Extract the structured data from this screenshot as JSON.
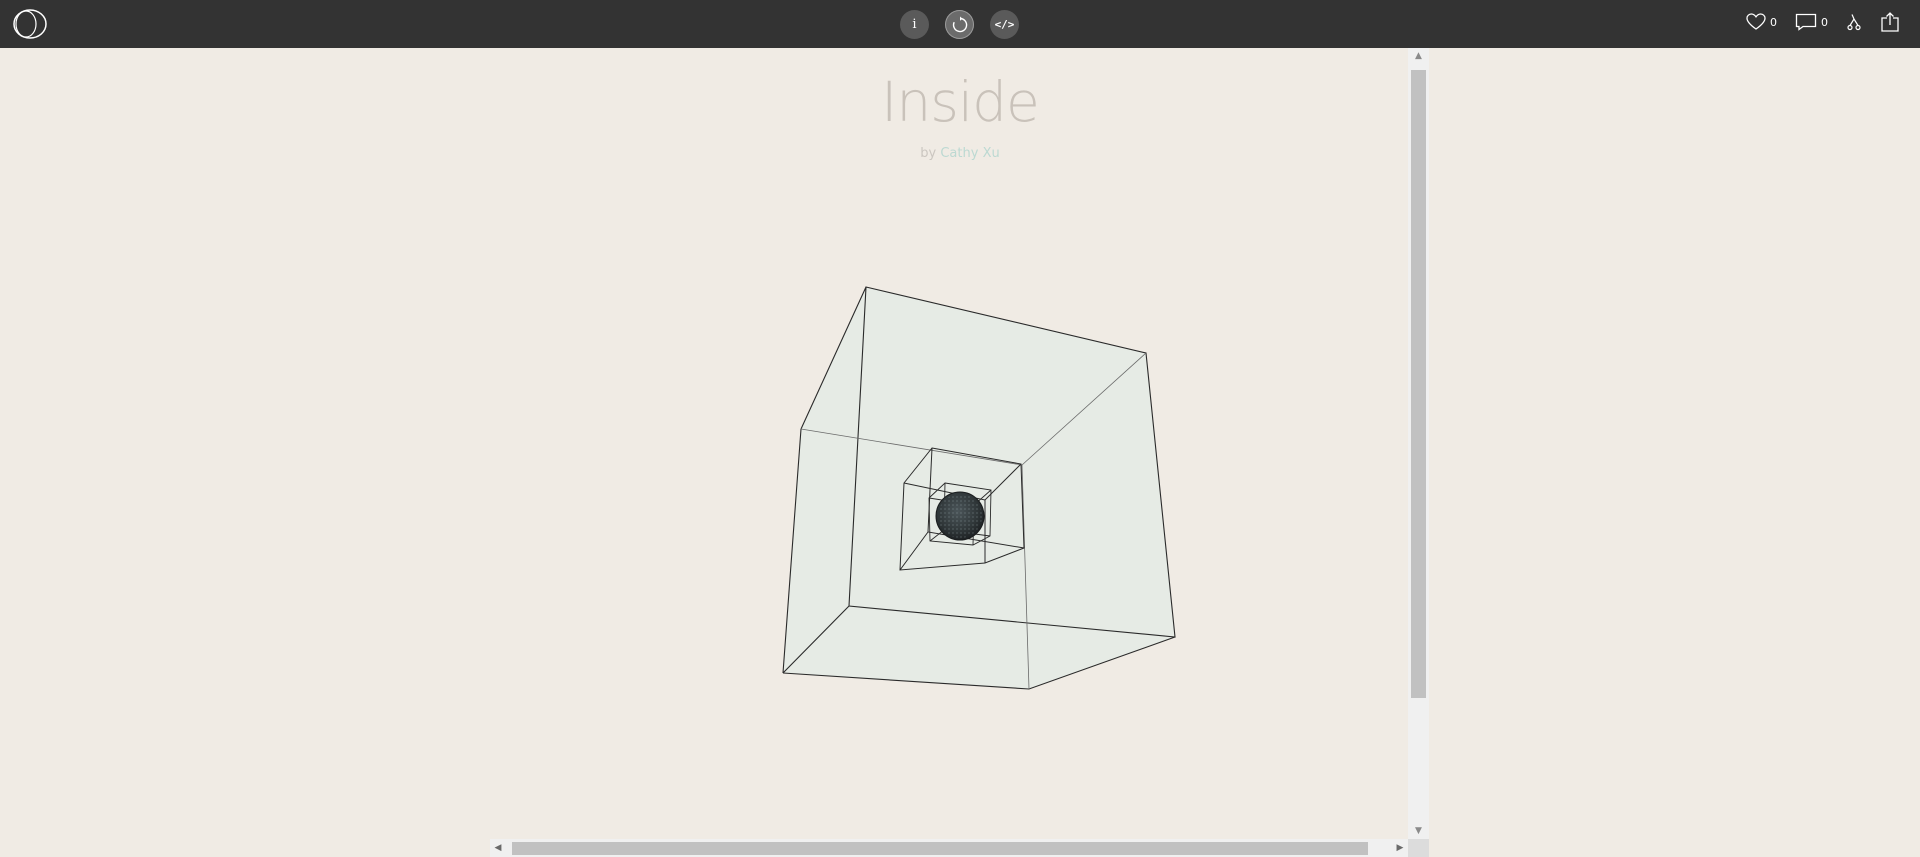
{
  "topbar": {
    "logo_icon": "openprocessing-logo-icon",
    "controls": [
      {
        "name": "info",
        "label": "i",
        "icon": "info-icon"
      },
      {
        "name": "restart",
        "label": "",
        "icon": "restart-icon"
      },
      {
        "name": "code",
        "label": "</>",
        "icon": "code-icon"
      }
    ],
    "likes_count": "0",
    "comments_count": "0"
  },
  "sketch": {
    "title": "Inside",
    "by_prefix": "by",
    "author": "Cathy Xu"
  },
  "colors": {
    "topbar_bg": "#333333",
    "canvas_bg": "#f0ebe4",
    "cube_fill": "#e6ebe5",
    "author_link": "#bcd9d2"
  }
}
